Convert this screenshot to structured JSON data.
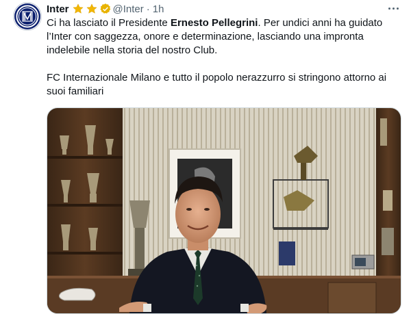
{
  "tweet": {
    "name": "Inter",
    "handle": "@Inter",
    "time": "1h",
    "separator": "·",
    "text_line1_pre": "Ci ha lasciato il Presidente ",
    "text_line1_bold": "Ernesto Pellegrini",
    "text_line1_post": ". Per undici anni ha guidato l’Inter con saggezza, onore e determinazione, lasciando una impronta indelebile nella storia del nostro Club.",
    "text_paragraph2": "FC Internazionale Milano e tutto il popolo nerazzurro si stringono attorno ai suoi familiari",
    "stars": 2,
    "colors": {
      "star": "#f2b705",
      "verified": "#e8b300",
      "avatar_bg": "#0b1f6e",
      "handle": "#536471"
    },
    "icons": {
      "avatar": "inter-logo",
      "star": "star-icon",
      "verified": "verified-badge-icon",
      "more": "more-options-icon"
    },
    "media": {
      "kind": "photo"
    }
  }
}
